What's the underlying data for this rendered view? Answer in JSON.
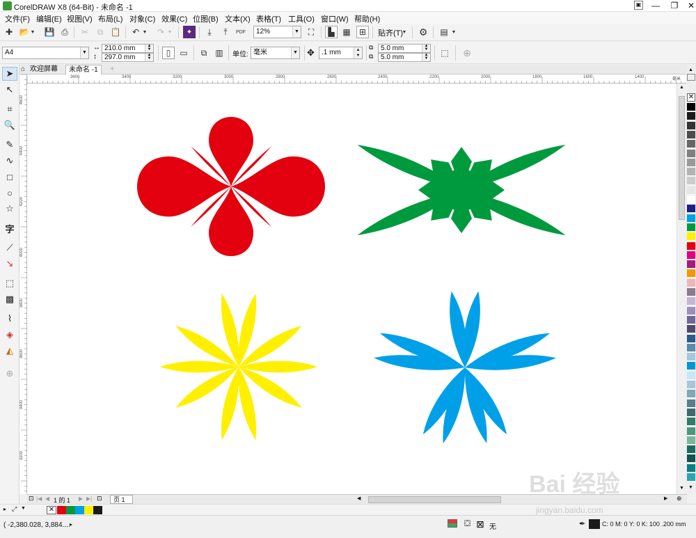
{
  "window": {
    "title": "CorelDRAW X8 (64-Bit) - 未命名 -1",
    "controls": [
      "—",
      "❐",
      "✕"
    ]
  },
  "menu": [
    "文件(F)",
    "编辑(E)",
    "视图(V)",
    "布局(L)",
    "对象(C)",
    "效果(C)",
    "位图(B)",
    "文本(X)",
    "表格(T)",
    "工具(O)",
    "窗口(W)",
    "帮助(H)"
  ],
  "standard_toolbar": {
    "zoom": "12%",
    "snap_label": "贴齐(T)",
    "pdf_label": "PDF"
  },
  "property_bar": {
    "page_size": "A4",
    "width": "210.0 mm",
    "height": "297.0 mm",
    "units_label": "单位:",
    "units": "毫米",
    "nudge": ".1 mm",
    "dup_x": "5.0 mm",
    "dup_y": "5.0 mm"
  },
  "doc_tabs": {
    "welcome": "欢迎屏幕",
    "document": "未命名 -1"
  },
  "ruler": {
    "horizontal": [
      "3600",
      "3400",
      "3200",
      "3000",
      "2800",
      "2600",
      "2400",
      "2200",
      "2000",
      "1800",
      "1600",
      "1400"
    ],
    "unit": "毫米",
    "vertical": [
      "4600",
      "4400",
      "4200",
      "4000",
      "3800",
      "3600",
      "3400",
      "3200"
    ]
  },
  "shapes": {
    "red_flower_color": "#e3000f",
    "green_star_color": "#009a3e",
    "yellow_flower_color": "#fff000",
    "blue_flower_color": "#00a0e9"
  },
  "palette_colors": [
    "#000000",
    "#1a1a1a",
    "#333333",
    "#4d4d4d",
    "#666666",
    "#808080",
    "#999999",
    "#b3b3b3",
    "#cccccc",
    "#e6e6e6",
    "#ffffff",
    "#1d2088",
    "#00a0e9",
    "#009a3e",
    "#fff000",
    "#e3000f",
    "#e4007f",
    "#a01e7c",
    "#f39800",
    "#f5b3b5",
    "#8c7b8c",
    "#c5b6d6",
    "#9c8fbe",
    "#6d6895",
    "#4f4a6e",
    "#2a5b8c",
    "#5c8aa8",
    "#a3c8e0",
    "#0097d6",
    "#c9e6f4",
    "#a7c6d8",
    "#7fa8b8",
    "#557f8f",
    "#3d6b6b",
    "#2f7d6a",
    "#4a9a7a",
    "#7ab89a",
    "#1a6b5e",
    "#0f5550",
    "#0a8080",
    "#2ba6b0"
  ],
  "page_nav": {
    "page_info": "1 的 1",
    "page_tab": "页 1"
  },
  "doc_palette": [
    "#e3000f",
    "#009a3e",
    "#00a0e9",
    "#fff000",
    "#1a1a1a"
  ],
  "status": {
    "coords": "( -2,380.028, 3,884....",
    "fill_none": "无",
    "outline": "C: 0 M: 0 Y: 0 K: 100  .200 mm"
  },
  "watermark": {
    "text": "Bai 经验",
    "url": "jingyan.baidu.com"
  }
}
